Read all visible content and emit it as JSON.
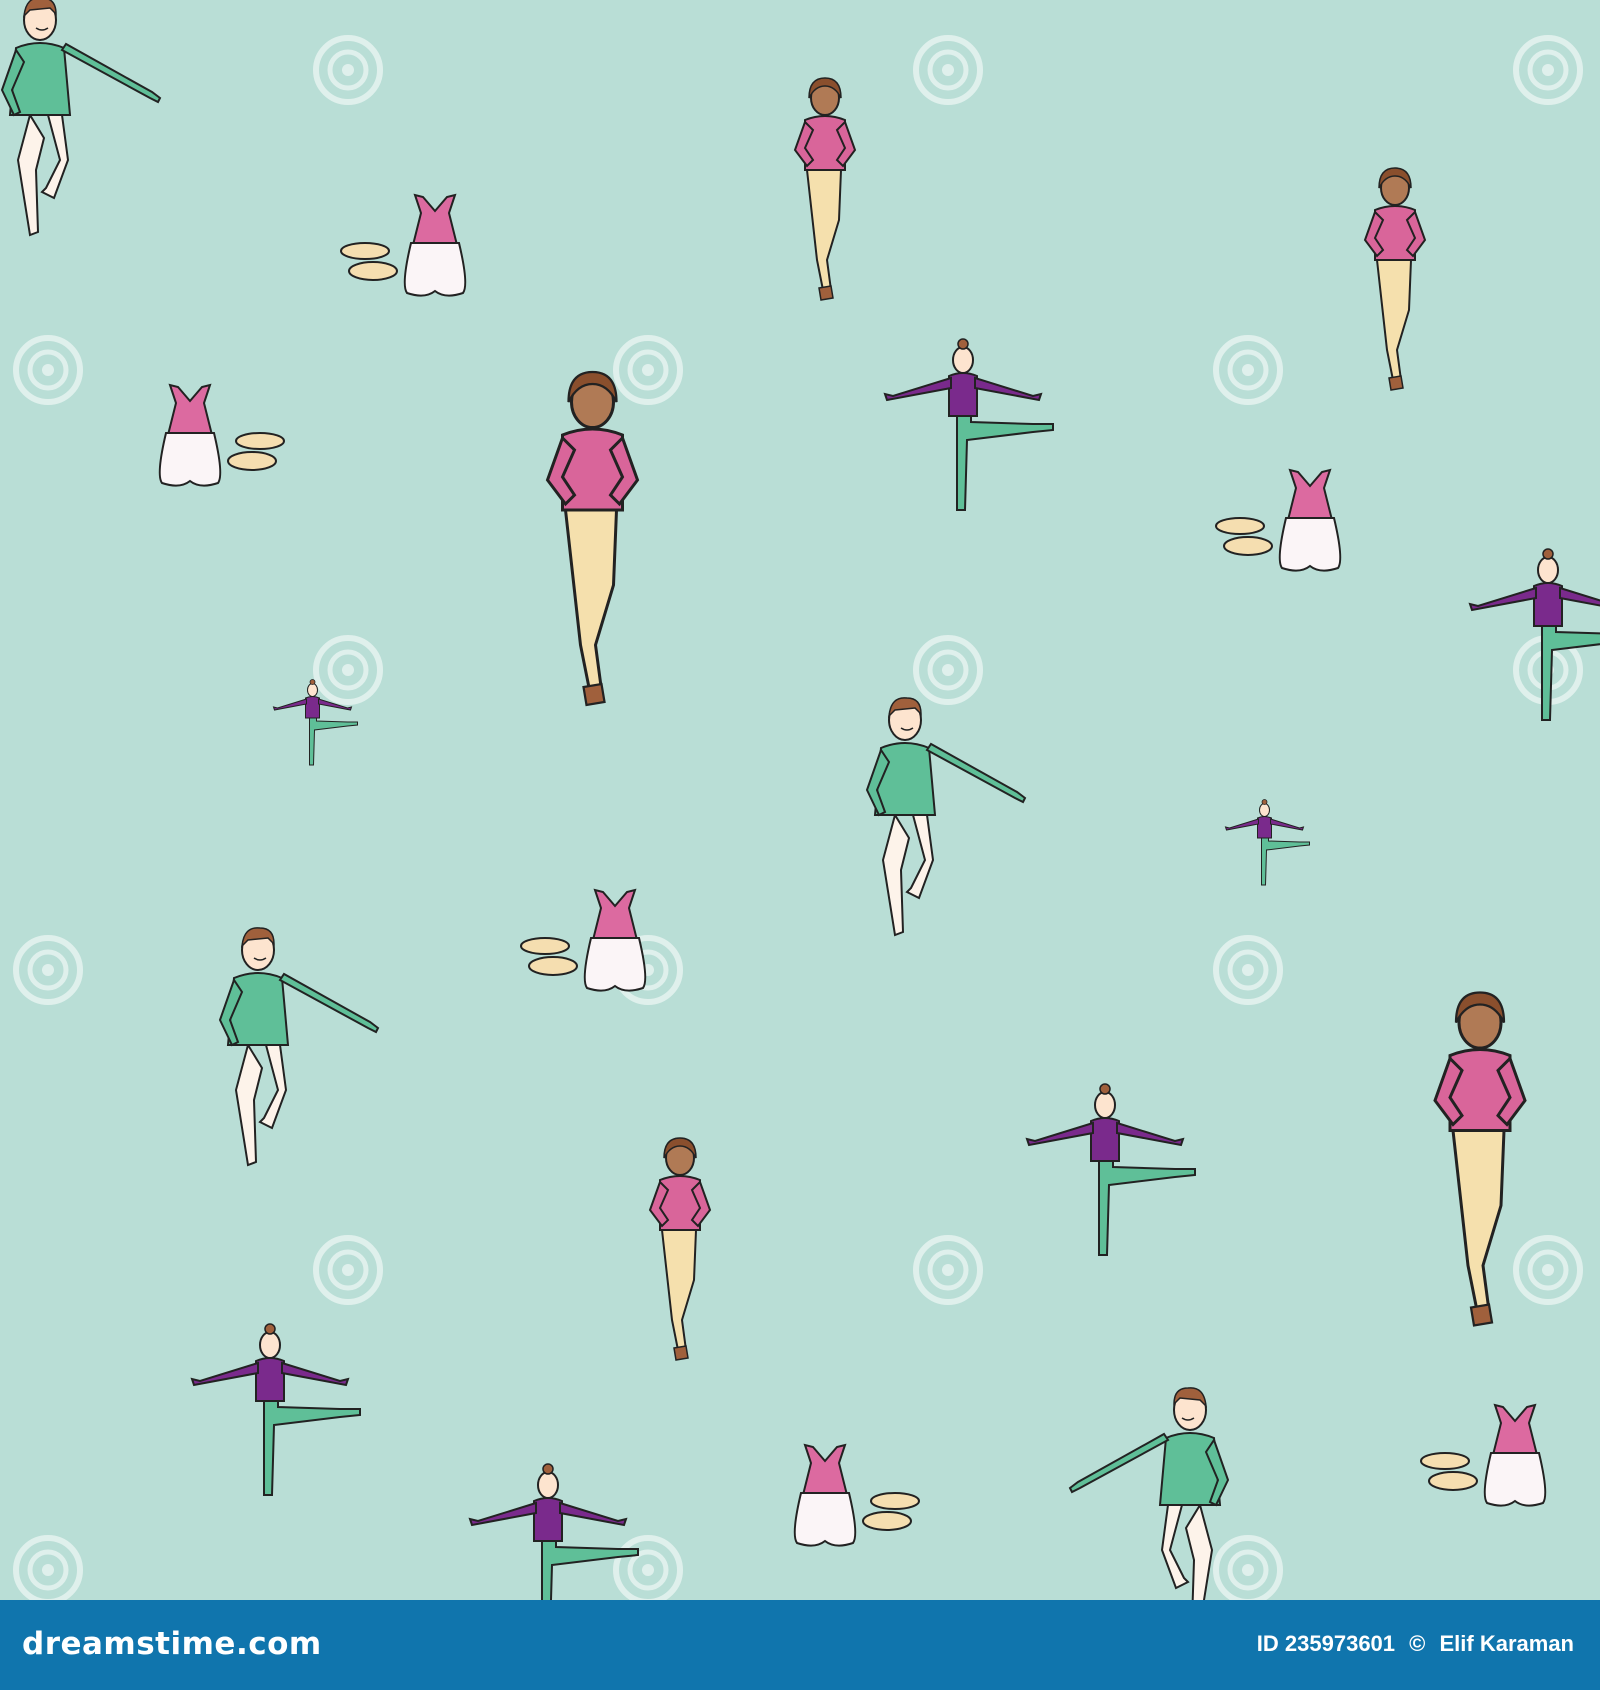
{
  "image": {
    "subject": "seamless-ballet-pattern",
    "background_color": "#b9ded6",
    "figures": {
      "boy_dancer": {
        "top": "#5fbf98",
        "trousers": "#fdf3ea",
        "hair": "#a0603c"
      },
      "girl_dancer": {
        "top": "#d9659a",
        "trousers": "#f5e0ad",
        "hair": "#8a4f2d"
      },
      "ballerina": {
        "top": "#7a2a8c",
        "tights": "#5fbf98",
        "hair": "#a0603c"
      },
      "outfit": {
        "leotard": "#dc6aa0",
        "skirt": "#fbf5f7",
        "slippers": "#f5deb0"
      }
    },
    "watermark_text": "dreamstime"
  },
  "footer": {
    "background_color": "#1075ad",
    "brand": "dreamstime.com",
    "id_label": "ID 235973601",
    "copyright": "©",
    "author": "Elif Karaman"
  }
}
